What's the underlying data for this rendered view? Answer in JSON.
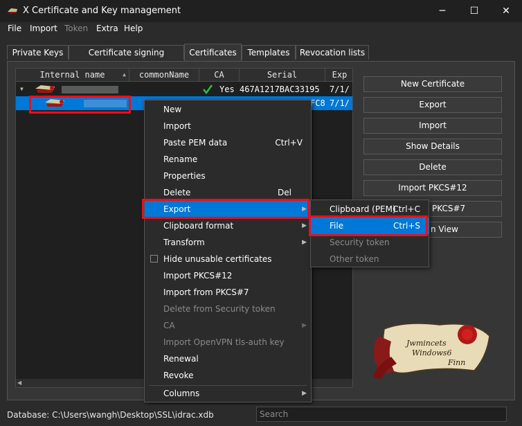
{
  "window": {
    "title": "X Certificate and Key management",
    "minimize_glyph": "─",
    "maximize_glyph": "☐",
    "close_glyph": "✕"
  },
  "menubar": [
    {
      "label": "File",
      "enabled": true
    },
    {
      "label": "Import",
      "enabled": true
    },
    {
      "label": "Token",
      "enabled": false
    },
    {
      "label": "Extra",
      "enabled": true
    },
    {
      "label": "Help",
      "enabled": true
    }
  ],
  "tabs": [
    {
      "label": "Private Keys",
      "active": false
    },
    {
      "label": "Certificate signing requests",
      "active": false
    },
    {
      "label": "Certificates",
      "active": true
    },
    {
      "label": "Templates",
      "active": false
    },
    {
      "label": "Revocation lists",
      "active": false
    }
  ],
  "table": {
    "columns": [
      "Internal name",
      "commonName",
      "CA",
      "Serial",
      "Exp"
    ],
    "sort_glyph": "▲",
    "rows": [
      {
        "ca": "Yes",
        "serial": "467A1217BAC33195",
        "expiry": "7/1/",
        "selected": false
      },
      {
        "ca": "",
        "serial": "FC8",
        "expiry": "7/1/",
        "selected": true
      }
    ]
  },
  "buttons": {
    "new_certificate": "New Certificate",
    "export": "Export",
    "import": "Import",
    "show_details": "Show Details",
    "delete": "Delete",
    "import_pkcs12": "Import PKCS#12",
    "import_pkcs7_visible": "PKCS#7",
    "view_visible": "n View"
  },
  "context_menu": {
    "items": [
      {
        "label": "New",
        "shortcut": "",
        "submenu": false,
        "enabled": true
      },
      {
        "label": "Import",
        "shortcut": "",
        "submenu": false,
        "enabled": true
      },
      {
        "label": "Paste PEM data",
        "shortcut": "Ctrl+V",
        "submenu": false,
        "enabled": true
      },
      {
        "label": "Rename",
        "shortcut": "",
        "submenu": false,
        "enabled": true
      },
      {
        "label": "Properties",
        "shortcut": "",
        "submenu": false,
        "enabled": true
      },
      {
        "label": "Delete",
        "shortcut": "Del",
        "submenu": false,
        "enabled": true
      },
      {
        "label": "Export",
        "shortcut": "",
        "submenu": true,
        "enabled": true,
        "highlighted": true
      },
      {
        "label": "Clipboard format",
        "shortcut": "",
        "submenu": true,
        "enabled": true
      },
      {
        "label": "Transform",
        "shortcut": "",
        "submenu": true,
        "enabled": true
      },
      {
        "label": "Hide unusable certificates",
        "shortcut": "",
        "submenu": false,
        "enabled": true,
        "checkbox": true
      },
      {
        "label": "Import PKCS#12",
        "shortcut": "",
        "submenu": false,
        "enabled": true
      },
      {
        "label": "Import from PKCS#7",
        "shortcut": "",
        "submenu": false,
        "enabled": true
      },
      {
        "label": "Delete from Security token",
        "shortcut": "",
        "submenu": false,
        "enabled": false
      },
      {
        "label": "CA",
        "shortcut": "",
        "submenu": true,
        "enabled": false
      },
      {
        "label": "Import OpenVPN tls-auth key",
        "shortcut": "",
        "submenu": false,
        "enabled": false
      },
      {
        "label": "Renewal",
        "shortcut": "",
        "submenu": false,
        "enabled": true
      },
      {
        "label": "Revoke",
        "shortcut": "",
        "submenu": false,
        "enabled": true
      },
      {
        "label": "Columns",
        "shortcut": "",
        "submenu": true,
        "enabled": true
      }
    ],
    "submenu_glyph": "▶"
  },
  "export_submenu": {
    "items": [
      {
        "label": "Clipboard (PEM)",
        "shortcut": "Ctrl+C",
        "enabled": true
      },
      {
        "label": "File",
        "shortcut": "Ctrl+S",
        "enabled": true,
        "highlighted": true
      },
      {
        "label": "Security token",
        "shortcut": "",
        "enabled": false
      },
      {
        "label": "Other token",
        "shortcut": "",
        "enabled": false
      }
    ]
  },
  "logo_text": {
    "line1": "Jwmincets",
    "line2": "Windows6",
    "line3": "Finn"
  },
  "status": {
    "database": "Database: C:\\Users\\wangh\\Desktop\\SSL\\idrac.xdb",
    "search_placeholder": "Search"
  },
  "colors": {
    "highlight": "#0078d7",
    "annotation_red": "#e8101c",
    "check_green": "#2fbf40"
  }
}
